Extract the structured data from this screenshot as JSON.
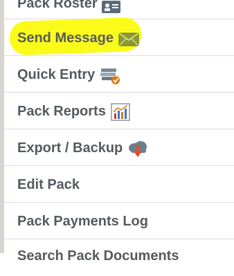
{
  "menu": {
    "items": [
      {
        "label": "Pack Roster",
        "icon": "roster-card-icon"
      },
      {
        "label": "Send Message",
        "icon": "envelope-icon"
      },
      {
        "label": "Quick Entry",
        "icon": "books-check-icon"
      },
      {
        "label": "Pack Reports",
        "icon": "bar-chart-icon"
      },
      {
        "label": "Export / Backup",
        "icon": "cloud-download-icon"
      },
      {
        "label": "Edit Pack",
        "icon": ""
      },
      {
        "label": "Pack Payments Log",
        "icon": ""
      },
      {
        "label": "Search Pack Documents",
        "icon": ""
      }
    ],
    "highlight_color": "#fbfb1a"
  }
}
